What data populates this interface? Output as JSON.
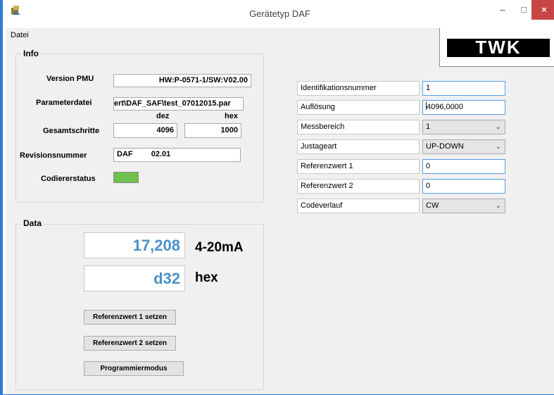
{
  "window": {
    "title": "Gerätetyp  DAF",
    "min_glyph": "–",
    "max_glyph": "□",
    "close_glyph": "×"
  },
  "menu": {
    "file": "Datei"
  },
  "logo": {
    "text": "TWK"
  },
  "info": {
    "legend": "Info",
    "version_label": "Version PMU",
    "version_value": "HW:P-0571-1/SW:V02.00",
    "paramfile_label": "Parameterdatei",
    "paramfile_value": "ert\\DAF_SAF\\test_07012015.par",
    "dez_header": "dez",
    "hex_header": "hex",
    "steps_label": "Gesamtschritte",
    "steps_dez": "4096",
    "steps_hex": "1000",
    "revision_label": "Revisionsnummer",
    "revision_type": "DAF",
    "revision_number": "02.01",
    "encoder_label": "Codiererstatus",
    "encoder_color": "#6ec24f"
  },
  "data": {
    "legend": "Data",
    "value_ma": "17,208",
    "unit_ma": "4-20mA",
    "value_hex": "d32",
    "unit_hex": "hex",
    "btn_ref1": "Referenzwert 1 setzen",
    "btn_ref2": "Referenzwert 2 setzen",
    "btn_prog": "Programmiermodus"
  },
  "params": [
    {
      "label": "Identifikationsnummer",
      "value": "1",
      "kind": "text"
    },
    {
      "label": "Auflösung",
      "value": "4096,0000",
      "kind": "text"
    },
    {
      "label": "Messbereich",
      "value": "1",
      "kind": "combo"
    },
    {
      "label": "Justageart",
      "value": "UP-DOWN",
      "kind": "combo"
    },
    {
      "label": "Referenzwert 1",
      "value": "0",
      "kind": "text"
    },
    {
      "label": "Referenzwert 2",
      "value": "0",
      "kind": "text"
    },
    {
      "label": "Codeverlauf",
      "value": "CW",
      "kind": "combo"
    }
  ],
  "colors": {
    "accent_blue": "#4a90c8",
    "close_red": "#c74645",
    "status_green": "#6ec24f"
  }
}
